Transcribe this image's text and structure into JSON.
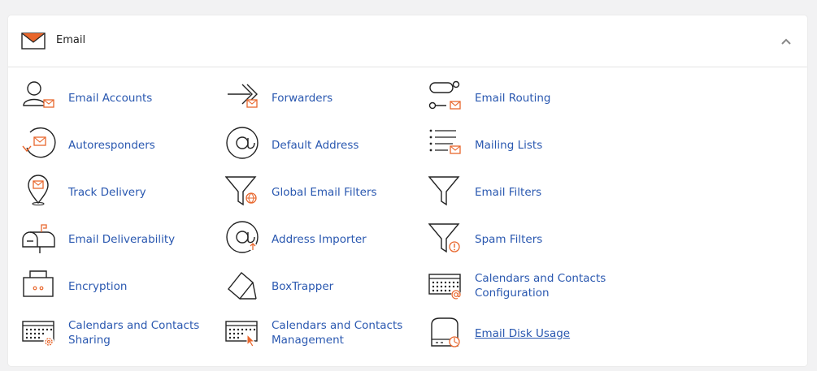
{
  "panel": {
    "title": "Email",
    "icons": {
      "header": "envelope-icon",
      "collapse": "chevron-up-icon"
    },
    "accent_color": "#e8662c",
    "link_color": "#2a58b0"
  },
  "items": [
    {
      "label": "Email Accounts",
      "icon": "user-mail-icon"
    },
    {
      "label": "Forwarders",
      "icon": "forward-arrow-icon"
    },
    {
      "label": "Email Routing",
      "icon": "routing-icon"
    },
    {
      "label": "Autoresponders",
      "icon": "autoresponder-icon"
    },
    {
      "label": "Default Address",
      "icon": "at-sign-icon"
    },
    {
      "label": "Mailing Lists",
      "icon": "list-mail-icon"
    },
    {
      "label": "Track Delivery",
      "icon": "location-pin-icon"
    },
    {
      "label": "Global Email Filters",
      "icon": "funnel-globe-icon"
    },
    {
      "label": "Email Filters",
      "icon": "funnel-icon"
    },
    {
      "label": "Email Deliverability",
      "icon": "mailbox-icon"
    },
    {
      "label": "Address Importer",
      "icon": "at-import-icon"
    },
    {
      "label": "Spam Filters",
      "icon": "funnel-alert-icon"
    },
    {
      "label": "Encryption",
      "icon": "key-card-icon"
    },
    {
      "label": "BoxTrapper",
      "icon": "box-trap-icon"
    },
    {
      "label_line1": "Calendars and Contacts",
      "label_line2": "Configuration",
      "icon": "keyboard-at-icon"
    },
    {
      "label_line1": "Calendars and Contacts",
      "label_line2": "Sharing",
      "icon": "keyboard-gear-icon"
    },
    {
      "label_line1": "Calendars and Contacts",
      "label_line2": "Management",
      "icon": "keyboard-cursor-icon"
    },
    {
      "label": "Email Disk Usage",
      "icon": "disk-usage-icon"
    }
  ]
}
